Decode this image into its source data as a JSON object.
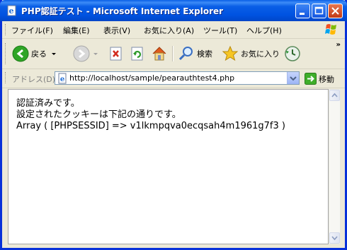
{
  "window": {
    "title": "PHP認証テスト - Microsoft Internet Explorer"
  },
  "menubar": {
    "items": [
      "ファイル(F)",
      "編集(E)",
      "表示(V)",
      "お気に入り(A)",
      "ツール(T)",
      "ヘルプ(H)"
    ]
  },
  "toolbar": {
    "back_label": "戻る",
    "search_label": "検索",
    "favorites_label": "お気に入り",
    "overflow": "»"
  },
  "address": {
    "label": "アドレス(D)",
    "url": "http://localhost/sample/pearauthtest4.php",
    "go_label": "移動"
  },
  "content": {
    "lines": [
      "認証済みです。",
      "設定されたクッキーは下記の通りです。",
      "Array ( [PHPSESSID] => v1lkmpqva0ecqsah4m1961g7f3 )"
    ]
  },
  "colors": {
    "titlebar": "#0054e3",
    "chrome": "#ece9d8",
    "close_button": "#c13a16"
  }
}
